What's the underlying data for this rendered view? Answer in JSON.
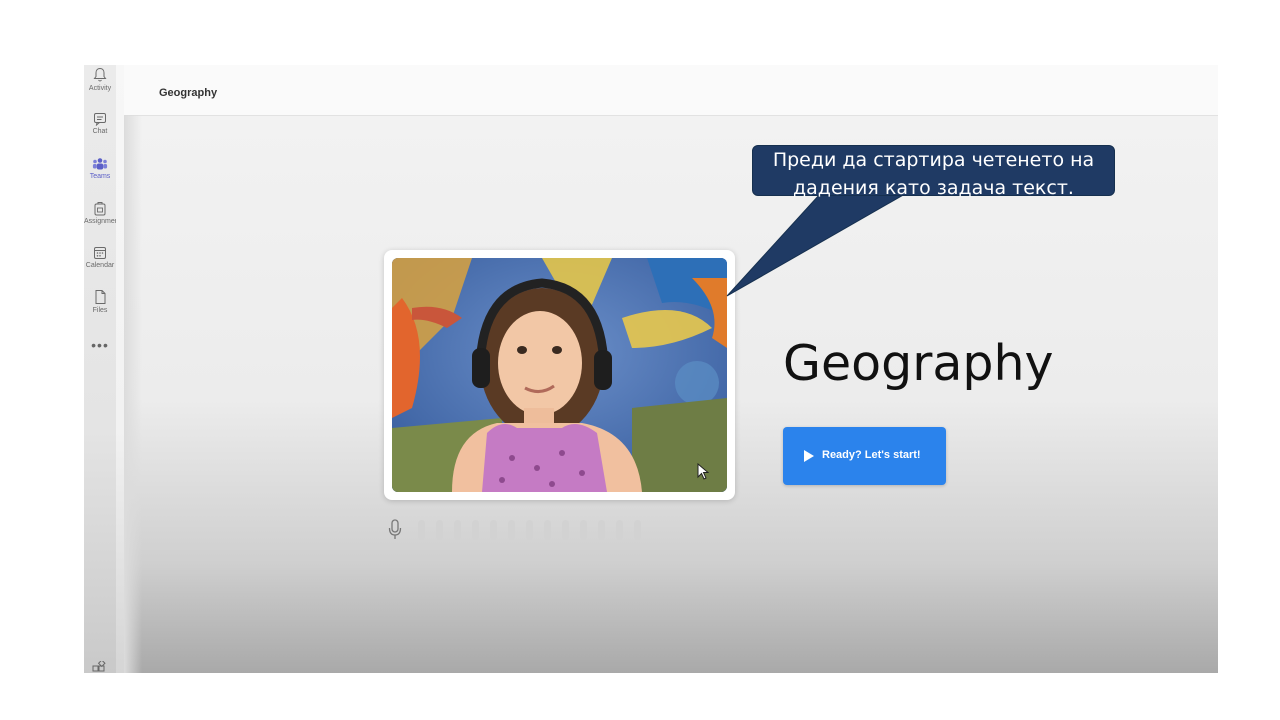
{
  "rail": {
    "items": [
      {
        "label": "Activity",
        "icon": "bell-icon"
      },
      {
        "label": "Chat",
        "icon": "chat-icon"
      },
      {
        "label": "Teams",
        "icon": "teams-icon",
        "active": true
      },
      {
        "label": "Assignments",
        "icon": "assignments-icon"
      },
      {
        "label": "Calendar",
        "icon": "calendar-icon"
      },
      {
        "label": "Files",
        "icon": "files-icon"
      }
    ],
    "more": "•••",
    "active_color": "#5b5fc7"
  },
  "header": {
    "title": "Geography"
  },
  "main": {
    "title": "Geography",
    "start_button_label": "Ready? Let's start!",
    "start_button_color": "#2b83ec"
  },
  "callout": {
    "text_line1": "Преди да стартира четенето на",
    "text_line2": "дадения като задача текст.",
    "color": "#1f3a64"
  }
}
